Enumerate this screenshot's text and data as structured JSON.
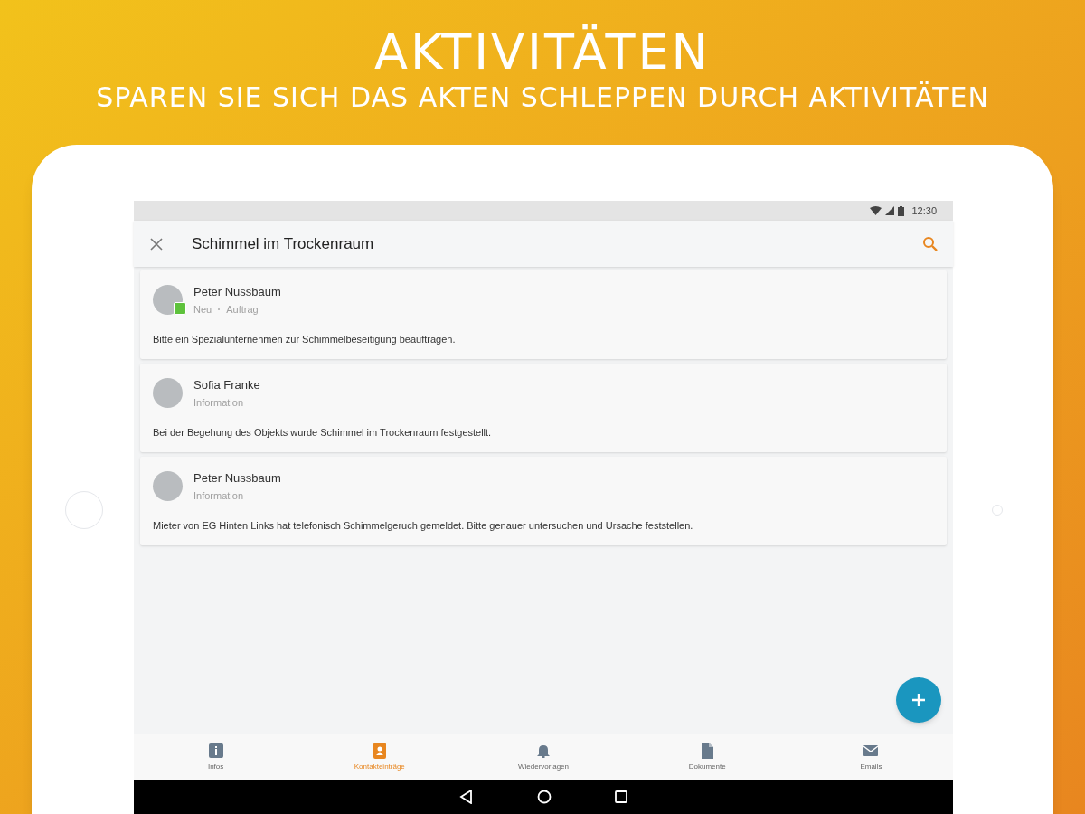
{
  "promo": {
    "title": "AKTIVITÄTEN",
    "subtitle": "SPAREN SIE SICH DAS AKTEN SCHLEPPEN DURCH AKTIVITÄTEN"
  },
  "status_bar": {
    "time": "12:30"
  },
  "app_bar": {
    "title": "Schimmel im Trockenraum"
  },
  "entries": [
    {
      "author": "Peter Nussbaum",
      "tags": [
        "Neu",
        "Auftrag"
      ],
      "badge": true,
      "text": "Bitte ein Spezialunternehmen zur Schimmelbeseitigung beauftragen."
    },
    {
      "author": "Sofia Franke",
      "tags": [
        "Information"
      ],
      "badge": false,
      "text": "Bei der Begehung des Objekts wurde Schimmel im Trockenraum festgestellt."
    },
    {
      "author": "Peter Nussbaum",
      "tags": [
        "Information"
      ],
      "badge": false,
      "text": "Mieter von EG Hinten Links hat telefonisch Schimmelgeruch gemeldet. Bitte genauer untersuchen und Ursache feststellen."
    }
  ],
  "bottom_nav": [
    {
      "kind": "info",
      "label": "Infos",
      "selected": false
    },
    {
      "kind": "contact",
      "label": "Kontakteinträge",
      "selected": true
    },
    {
      "kind": "bell",
      "label": "Wiedervorlagen",
      "selected": false
    },
    {
      "kind": "document",
      "label": "Dokumente",
      "selected": false
    },
    {
      "kind": "mail",
      "label": "Emails",
      "selected": false
    }
  ]
}
